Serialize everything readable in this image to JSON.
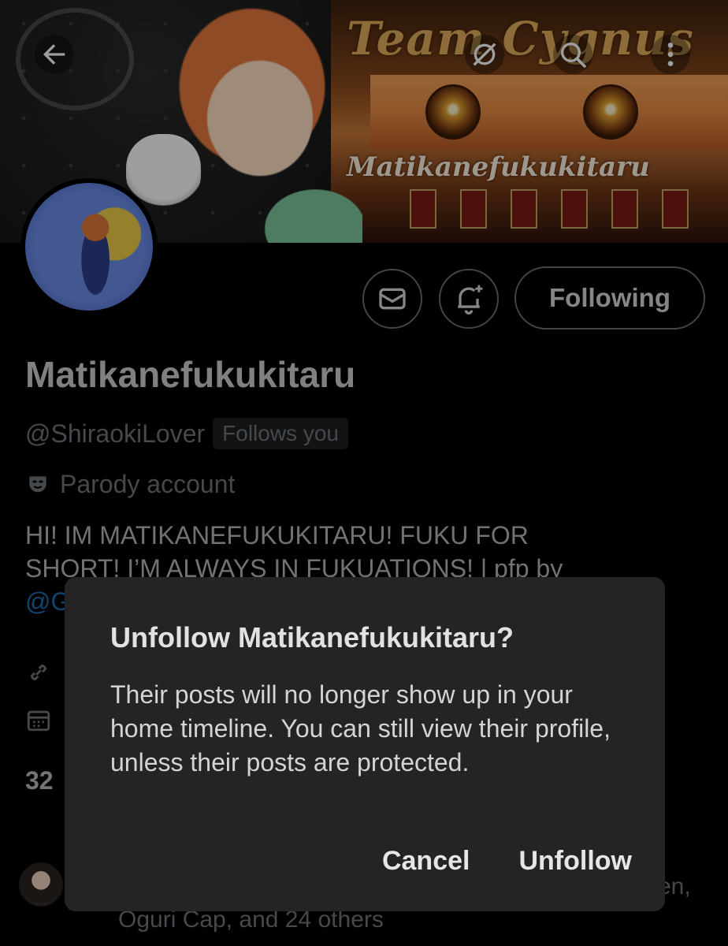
{
  "banner": {
    "team_text": "Team Cygnus",
    "name_script": "Matikanefukukitaru"
  },
  "icons": {
    "back": "arrow-left-icon",
    "grok": "grok-icon",
    "search": "search-icon",
    "more": "more-vertical-icon",
    "message": "envelope-icon",
    "notify": "bell-plus-icon",
    "parody": "theater-mask-icon",
    "link": "link-icon",
    "calendar": "calendar-icon"
  },
  "profile": {
    "display_name": "Matikanefukukitaru",
    "handle": "@ShiraokiLover",
    "follows_you": "Follows you",
    "parody_label": "Parody account",
    "bio_line1": "HI! IM MATIKANEFUKUKITARU! FUKU FOR",
    "bio_line2": "SHORT! I’M ALWAYS IN FUKUATIONS! | pfp by",
    "bio_mention": "@G",
    "follow_count_partial": "32",
    "followed_by_tail": "en,",
    "followed_by_line2": "Oguri Cap, and 24 others"
  },
  "actions": {
    "following_label": "Following"
  },
  "dialog": {
    "title": "Unfollow Matikanefukukitaru?",
    "body": "Their posts will no longer show up in your home timeline. You can still view their profile, unless their posts are protected.",
    "cancel_label": "Cancel",
    "unfollow_label": "Unfollow"
  },
  "colors": {
    "background": "#000000",
    "dialog_bg": "#242424",
    "muted_text": "#71767b",
    "link": "#1d6fb0",
    "border": "#6b6f73"
  }
}
